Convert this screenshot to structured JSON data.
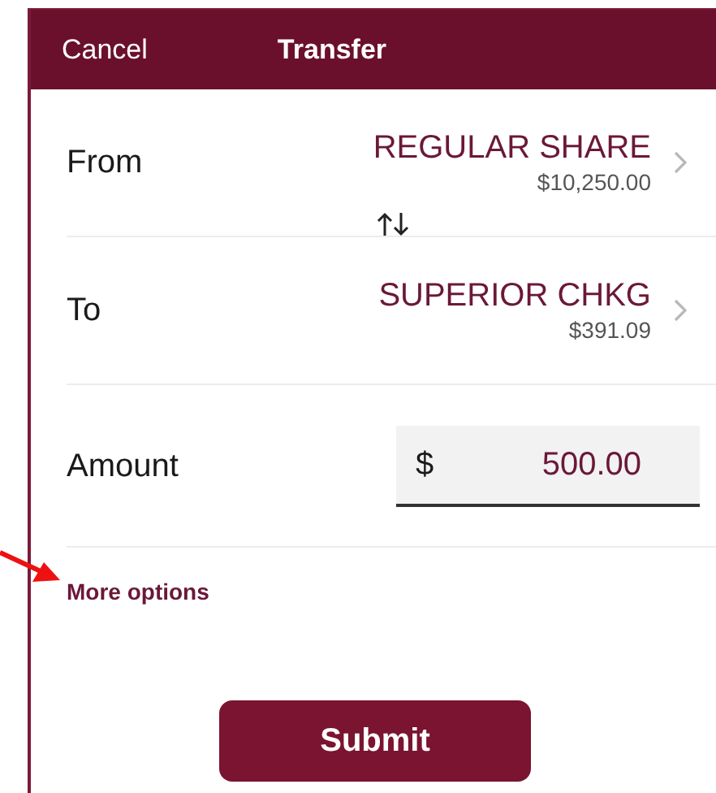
{
  "header": {
    "cancel": "Cancel",
    "title": "Transfer"
  },
  "accounts": [
    {
      "label": "From",
      "name": "REGULAR SHARE",
      "balance": "$10,250.00"
    },
    {
      "label": "To",
      "name": "SUPERIOR CHKG",
      "balance": "$391.09"
    }
  ],
  "amount": {
    "label": "Amount",
    "currency": "$",
    "value": "500.00"
  },
  "more_options": "More options",
  "submit": "Submit"
}
